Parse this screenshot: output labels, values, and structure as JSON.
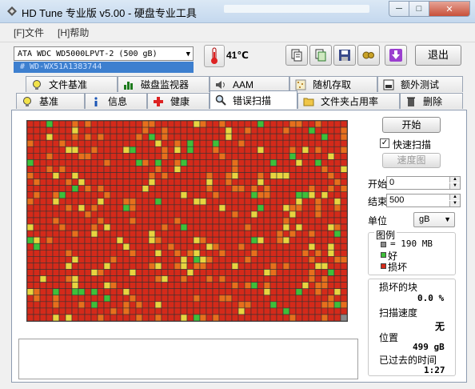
{
  "window": {
    "title": "HD Tune 专业版 v5.00 - 硬盘专业工具",
    "min_icon": "minimize-icon",
    "max_icon": "maximize-icon",
    "close_icon": "close-icon"
  },
  "menu": {
    "file": "[F]文件",
    "help": "[H]帮助"
  },
  "toolbar": {
    "drive": "ATA    WDC WD5000LPVT-2 (500 gB)",
    "serial": "#    WD-WX51A1383744",
    "temperature": "41℃",
    "exit_label": "退出"
  },
  "tabs": {
    "row1": [
      "文件基准",
      "磁盘监视器",
      "AAM",
      "随机存取",
      "额外测试"
    ],
    "row2": [
      "基准",
      "信息",
      "健康",
      "错误扫描",
      "文件夹占用率",
      "删除"
    ],
    "active": "错误扫描"
  },
  "scan": {
    "start_button": "开始",
    "quick_scan_label": "快速扫描",
    "quick_scan_checked": true,
    "speed_map_button": "速度图",
    "start_label": "开始",
    "start_value": "0",
    "end_label": "结束",
    "end_value": "500",
    "unit_label": "单位",
    "unit_value": "gB"
  },
  "legend": {
    "title": "图例",
    "block_size": "= 190 MB",
    "good": "好",
    "bad": "损坏"
  },
  "stats": {
    "damaged_label": "损坏的块",
    "damaged_value": "0.0 %",
    "speed_label": "扫描速度",
    "speed_value": "无",
    "position_label": "位置",
    "position_value": "499 gB",
    "elapsed_label": "已过去的时间",
    "elapsed_value": "1:27"
  },
  "colors": {
    "block_red": "#d42a1a",
    "block_orange": "#e76f1c",
    "block_yellow": "#e8d440",
    "block_green": "#3fbf3a",
    "block_gray": "#8a8a8a",
    "grid_line": "#333333"
  }
}
